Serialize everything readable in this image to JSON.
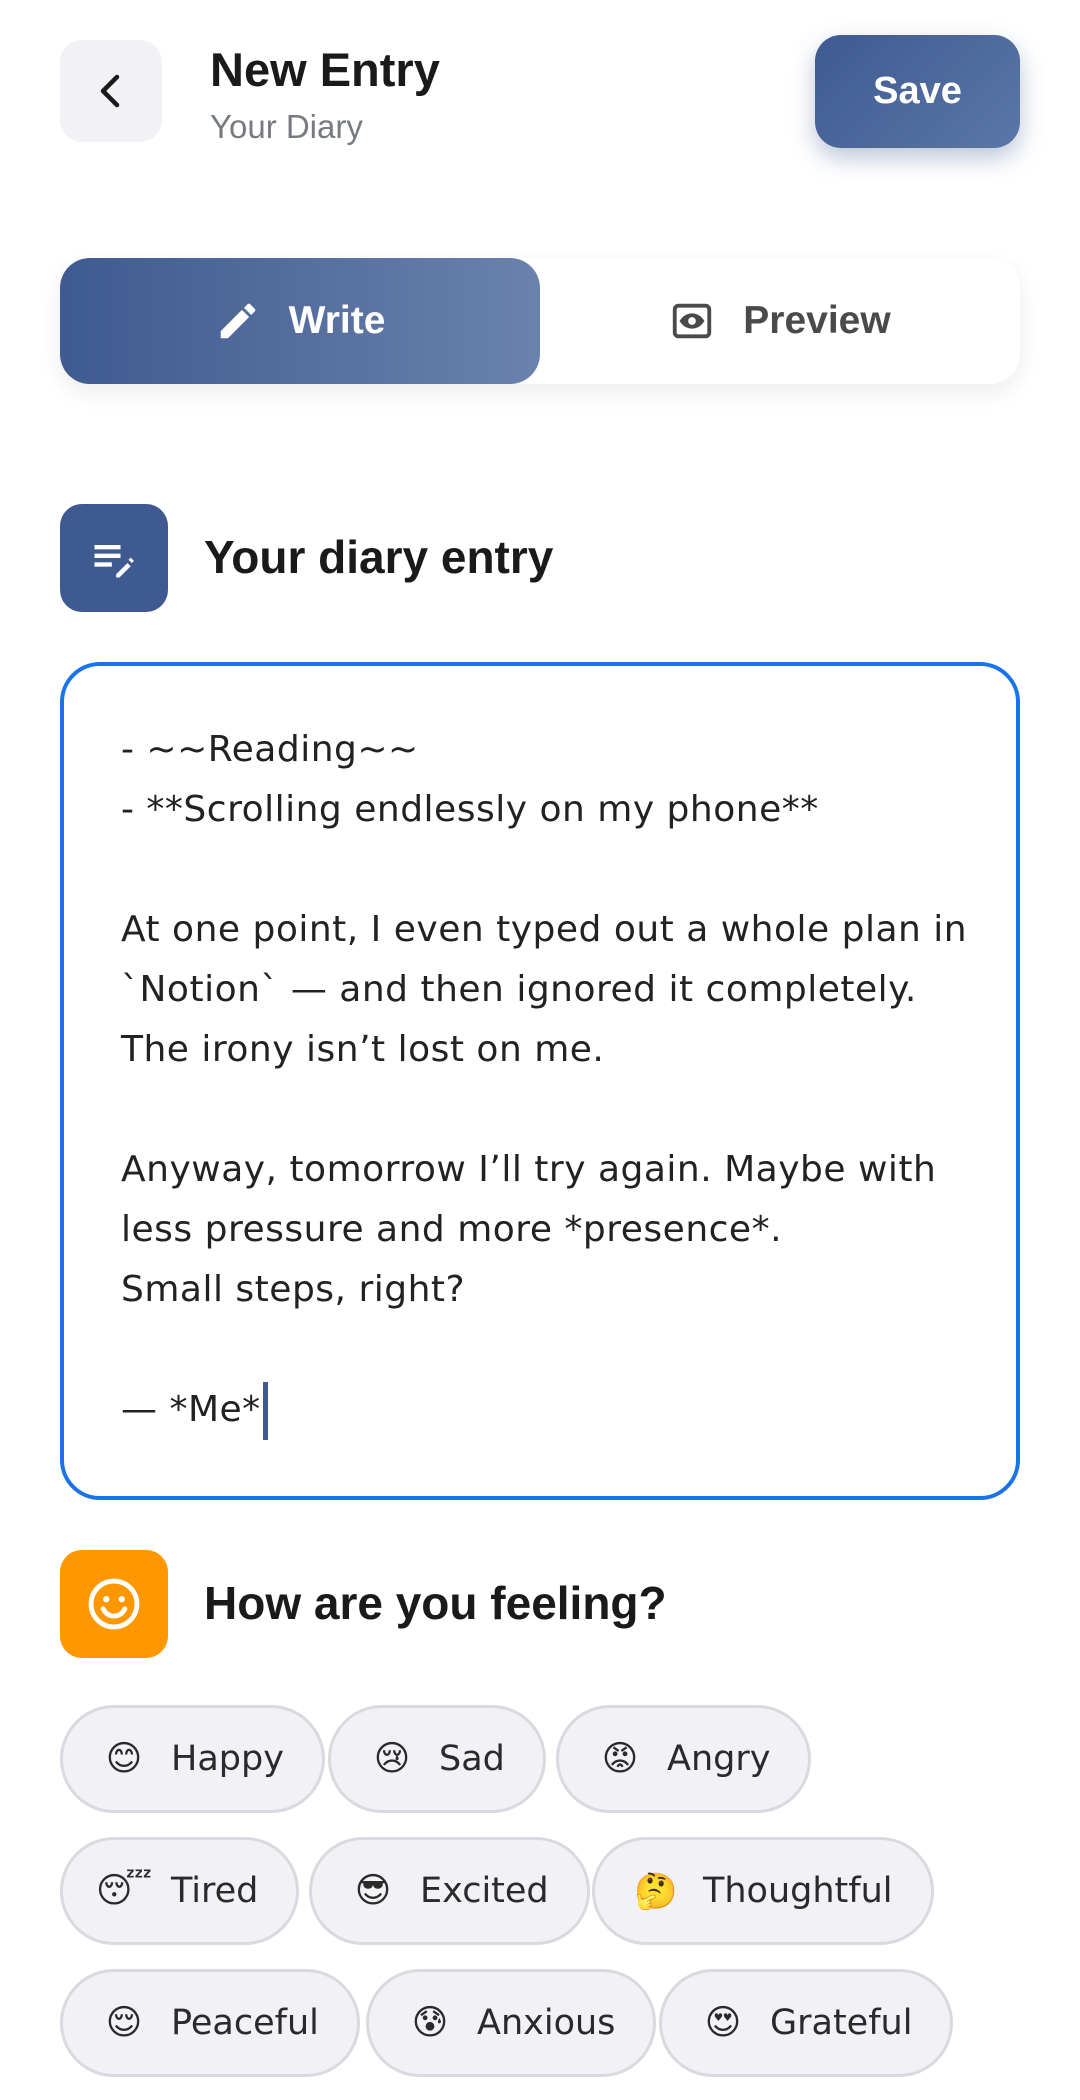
{
  "header": {
    "back_icon": "chevron-left-icon",
    "title": "New Entry",
    "subtitle": "Your Diary",
    "save_label": "Save"
  },
  "tabs": [
    {
      "label": "Write",
      "icon": "pencil-icon",
      "active": true
    },
    {
      "label": "Preview",
      "icon": "eye-preview-icon",
      "active": false
    }
  ],
  "entry_section": {
    "title": "Your diary entry",
    "icon": "notes-edit-icon",
    "lines": [
      "- ~~Reading~~",
      "- **Scrolling endlessly on my phone**",
      "",
      "At one point, I even typed out a whole plan in",
      "`Notion` — and then ignored it completely.",
      "The irony isn’t lost on me.",
      "",
      "Anyway, tomorrow I’ll try again. Maybe with",
      "less pressure and more *presence*.",
      "Small steps, right?",
      "",
      "— *Me*"
    ]
  },
  "mood_section": {
    "title": "How are you feeling?",
    "icon": "smiley-icon",
    "moods": [
      {
        "label": "Happy",
        "emoji": "😊"
      },
      {
        "label": "Sad",
        "emoji": "😢"
      },
      {
        "label": "Angry",
        "emoji": "😡"
      },
      {
        "label": "Tired",
        "emoji": "😴"
      },
      {
        "label": "Excited",
        "emoji": "😎"
      },
      {
        "label": "Thoughtful",
        "emoji": "🤔"
      },
      {
        "label": "Peaceful",
        "emoji": "😌"
      },
      {
        "label": "Anxious",
        "emoji": "😰"
      },
      {
        "label": "Grateful",
        "emoji": "😍"
      }
    ]
  },
  "colors": {
    "primary": "#3f5a90",
    "focus_border": "#1a73e8",
    "mood_icon_bg": "#ff9800"
  }
}
